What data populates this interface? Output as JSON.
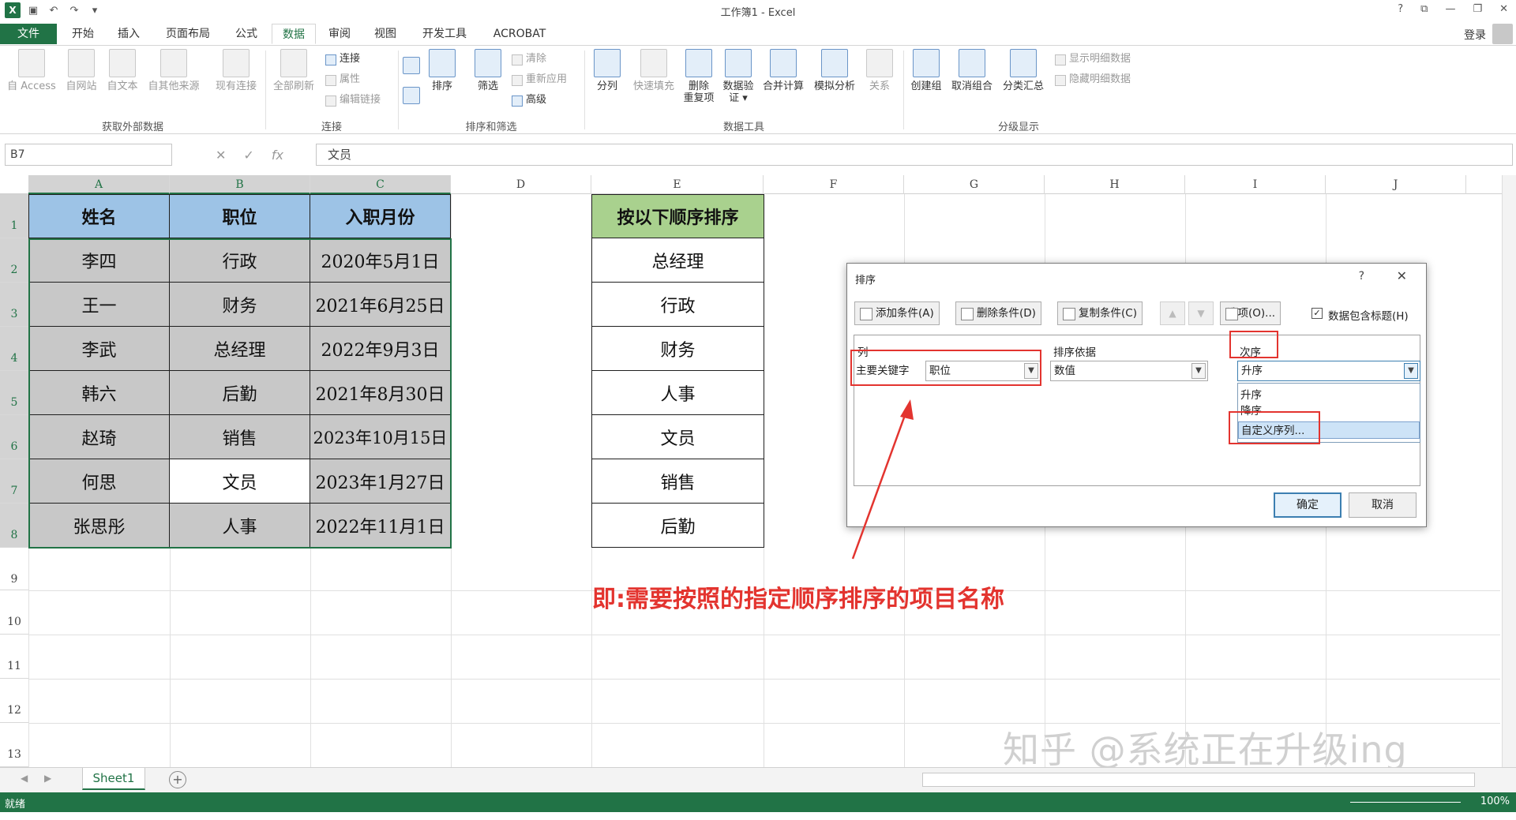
{
  "window": {
    "title": "工作簿1 - Excel",
    "controls": [
      "?",
      "⧉",
      "—",
      "❐",
      "✕"
    ]
  },
  "tabs": {
    "file": "文件",
    "home": "开始",
    "insert": "插入",
    "layout": "页面布局",
    "formulas": "公式",
    "data": "数据",
    "review": "审阅",
    "view": "视图",
    "developer": "开发工具",
    "acrobat": "ACROBAT",
    "login": "登录"
  },
  "ribbon": {
    "ext": {
      "access": "自 Access",
      "web": "自网站",
      "text": "自文本",
      "other": "自其他来源",
      "existing": "现有连接",
      "group": "获取外部数据"
    },
    "conn": {
      "refresh": "全部刷新",
      "connections": "连接",
      "properties": "属性",
      "edit_links": "编辑链接",
      "group": "连接"
    },
    "sort": {
      "sort": "排序",
      "filter": "筛选",
      "clear": "清除",
      "reapply": "重新应用",
      "advanced": "高级",
      "group": "排序和筛选"
    },
    "tools": {
      "split": "分列",
      "flash": "快速填充",
      "remove_dup": "删除\n重复项",
      "validate": "数据验\n证 ▾",
      "consolidate": "合并计算",
      "whatif": "模拟分析",
      "relations": "关系",
      "group": "数据工具"
    },
    "outline": {
      "group_btn": "创建组",
      "ungroup": "取消组合",
      "subtotal": "分类汇总",
      "show_detail": "显示明细数据",
      "hide_detail": "隐藏明细数据",
      "group": "分级显示"
    }
  },
  "formula_bar": {
    "name_box": "B7",
    "cancel": "✕",
    "enter": "✓",
    "fx": "fx",
    "formula": "文员"
  },
  "columns": [
    "A",
    "B",
    "C",
    "D",
    "E",
    "F",
    "G",
    "H",
    "I",
    "J"
  ],
  "rows": [
    "1",
    "2",
    "3",
    "4",
    "5",
    "6",
    "7",
    "8",
    "9",
    "10",
    "11",
    "12",
    "13"
  ],
  "table": {
    "headers": [
      "姓名",
      "职位",
      "入职月份"
    ],
    "rows": [
      [
        "李四",
        "行政",
        "2020年5月1日"
      ],
      [
        "王一",
        "财务",
        "2021年6月25日"
      ],
      [
        "李武",
        "总经理",
        "2022年9月3日"
      ],
      [
        "韩六",
        "后勤",
        "2021年8月30日"
      ],
      [
        "赵琦",
        "销售",
        "2023年10月15日"
      ],
      [
        "何思",
        "文员",
        "2023年1月27日"
      ],
      [
        "张思彤",
        "人事",
        "2022年11月1日"
      ]
    ]
  },
  "order_table": {
    "header": "按以下顺序排序",
    "items": [
      "总经理",
      "行政",
      "财务",
      "人事",
      "文员",
      "销售",
      "后勤"
    ]
  },
  "annotation": "即:需要按照的指定顺序排序的项目名称",
  "watermark": "知乎 @系统正在升级ing",
  "sheet_bar": {
    "sheet_tab": "Sheet1",
    "add": "+"
  },
  "status": {
    "ready": "就绪",
    "zoom": "100%"
  },
  "dialog": {
    "title": "排序",
    "help": "?",
    "close": "✕",
    "add_level": "添加条件(A)",
    "delete_level": "删除条件(D)",
    "copy_level": "复制条件(C)",
    "options": "选项(O)...",
    "has_headers": "数据包含标题(H)",
    "col_header": "列",
    "basis_header": "排序依据",
    "order_header": "次序",
    "primary_key_label": "主要关键字",
    "column_value": "职位",
    "basis_value": "数值",
    "order_value": "升序",
    "dropdown_options": [
      "升序",
      "降序",
      "自定义序列..."
    ],
    "ok": "确定",
    "cancel": "取消"
  },
  "colors": {
    "excel_green": "#217346",
    "header_blue": "#9dc3e6",
    "header_green": "#a9d18e",
    "annotation_red": "#e3342f"
  }
}
